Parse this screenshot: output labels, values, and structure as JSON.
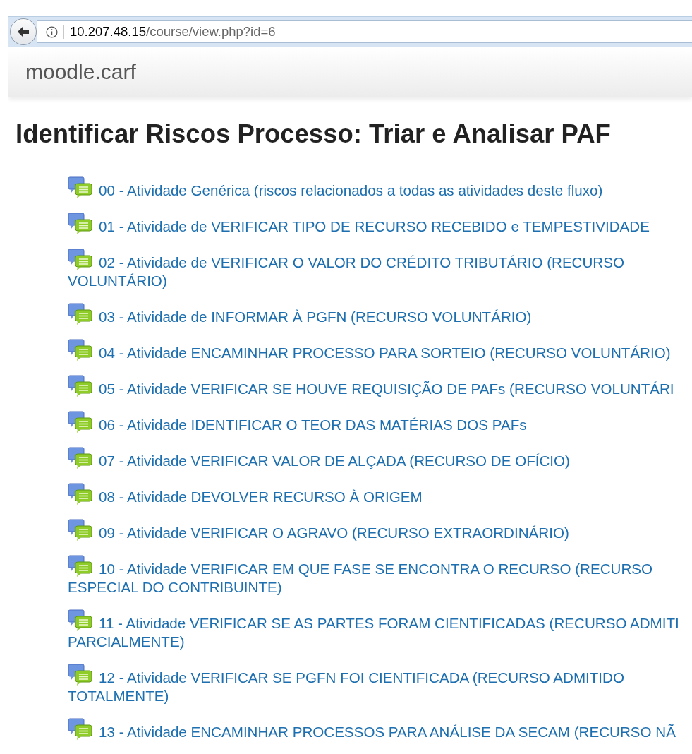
{
  "browser": {
    "url_host": "10.207.48.15",
    "url_path": "/course/view.php?id=6"
  },
  "navbar": {
    "brand": "moodle.carf"
  },
  "page": {
    "title": "Identificar Riscos Processo: Triar e Analisar PAF"
  },
  "activities": [
    {
      "lines": [
        "00 - Atividade Genérica (riscos relacionados a todas as atividades deste fluxo)"
      ]
    },
    {
      "lines": [
        "01 - Atividade de VERIFICAR TIPO DE RECURSO RECEBIDO e TEMPESTIVIDADE"
      ]
    },
    {
      "lines": [
        "02 - Atividade de VERIFICAR O VALOR DO CRÉDITO TRIBUTÁRIO (RECURSO",
        "VOLUNTÁRIO)"
      ]
    },
    {
      "lines": [
        "03 - Atividade de INFORMAR À PGFN (RECURSO VOLUNTÁRIO)"
      ]
    },
    {
      "lines": [
        "04 - Atividade ENCAMINHAR PROCESSO PARA SORTEIO (RECURSO VOLUNTÁRIO)"
      ]
    },
    {
      "lines": [
        "05 - Atividade VERIFICAR SE HOUVE REQUISIÇÃO DE PAFs (RECURSO VOLUNTÁRI"
      ]
    },
    {
      "lines": [
        "06 - Atividade IDENTIFICAR O TEOR DAS MATÉRIAS DOS PAFs"
      ]
    },
    {
      "lines": [
        "07 - Atividade VERIFICAR VALOR DE ALÇADA (RECURSO DE OFÍCIO)"
      ]
    },
    {
      "lines": [
        "08 - Atividade DEVOLVER RECURSO À ORIGEM"
      ]
    },
    {
      "lines": [
        "09 - Atividade VERIFICAR O AGRAVO (RECURSO EXTRAORDINÁRIO)"
      ]
    },
    {
      "lines": [
        "10 - Atividade VERIFICAR EM QUE FASE SE ENCONTRA O RECURSO (RECURSO",
        "ESPECIAL DO CONTRIBUINTE)"
      ]
    },
    {
      "lines": [
        "11 - Atividade VERIFICAR SE AS PARTES FORAM CIENTIFICADAS (RECURSO ADMITI",
        "PARCIALMENTE)"
      ]
    },
    {
      "lines": [
        "12 - Atividade VERIFICAR SE PGFN FOI CIENTIFICADA (RECURSO ADMITIDO",
        "TOTALMENTE)"
      ]
    },
    {
      "lines": [
        "13 - Atividade ENCAMINHAR PROCESSOS PARA ANÁLISE DA SECAM (RECURSO NÃ"
      ]
    }
  ]
}
